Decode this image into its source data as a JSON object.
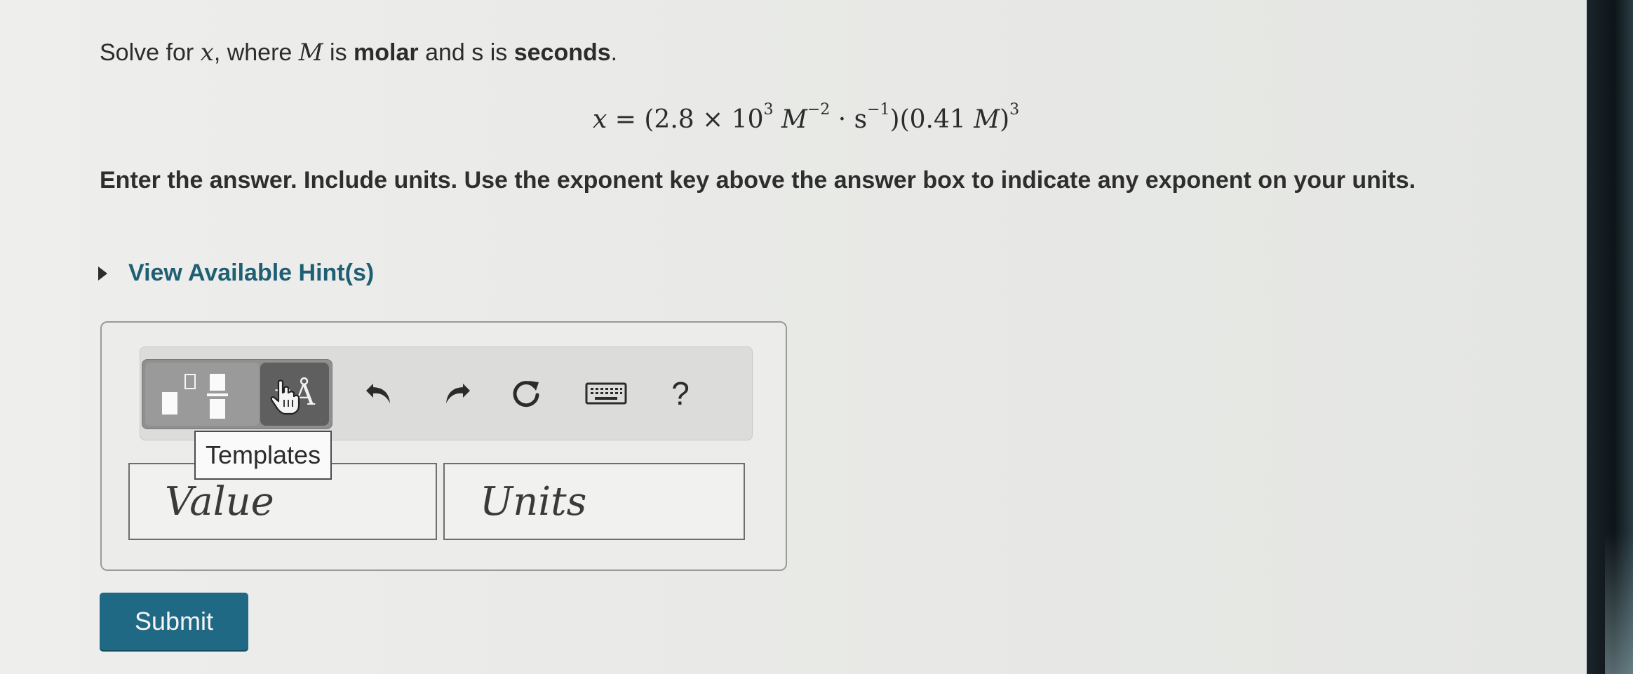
{
  "question": {
    "part1": "Solve for ",
    "var_x": "x",
    "part2": ", where ",
    "var_M": "M",
    "part3": " is ",
    "molar": "molar",
    "part4": " and s is ",
    "seconds": "seconds",
    "part5": "."
  },
  "equation": {
    "lhs": "x",
    "eq": " = (2.8 × 10",
    "exp1": "3",
    "unit1": " M",
    "exp2": "−2",
    "dot": " · s",
    "exp3": "−1",
    "mid": ")(0.41 ",
    "unit2": "M",
    "close": ")",
    "exp4": "3"
  },
  "instructions": "Enter the answer. Include units. Use the exponent key above the answer box to indicate any exponent on your units.",
  "hint": {
    "label": "View Available Hint(s)"
  },
  "toolbar": {
    "units_label": "μÅ",
    "help_label": "?",
    "tooltip": "Templates",
    "icons": [
      "templates-icon",
      "undo-icon",
      "redo-icon",
      "reset-icon",
      "keyboard-icon",
      "help-icon"
    ]
  },
  "answer": {
    "value_placeholder": "Value",
    "units_placeholder": "Units"
  },
  "submit_label": "Submit",
  "colors": {
    "accent": "#1f6985",
    "hint_link": "#1f5f73",
    "background": "#ebebe9"
  }
}
